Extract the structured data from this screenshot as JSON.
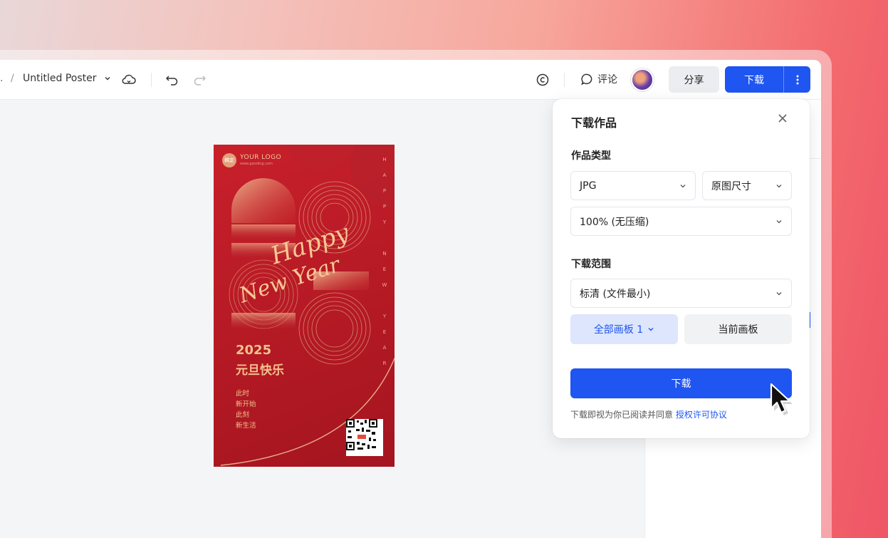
{
  "toolbar": {
    "breadcrumb_prefix": ".",
    "breadcrumb_separator": "/",
    "doc_title": "Untitled Poster",
    "comment_label": "评论",
    "share_label": "分享",
    "download_label": "下载"
  },
  "poster": {
    "logo_badge": "稿定",
    "logo_text": "YOUR LOGO",
    "logo_url": "www.gaoding.com",
    "vertical_text": "HAPPY NEW YEAR",
    "script_line1": "Happy",
    "script_line2": "New Year",
    "year": "2025",
    "title": "元旦快乐",
    "lines": [
      "此时",
      "新开始",
      "此刻",
      "新生活"
    ]
  },
  "download_panel": {
    "title": "下载作品",
    "type_label": "作品类型",
    "format_value": "JPG",
    "size_value": "原图尺寸",
    "quality_value": "100% (无压缩)",
    "range_label": "下载范围",
    "resolution_value": "标清 (文件最小)",
    "all_boards_label": "全部画板 1",
    "current_board_label": "当前画板",
    "download_button": "下载",
    "agreement_text": "下载即视为你已阅读并同意",
    "agreement_link": "授权许可协议"
  },
  "colors": {
    "primary": "#1f55f0",
    "poster_red": "#c8202b",
    "poster_gold": "#f2c08d"
  }
}
